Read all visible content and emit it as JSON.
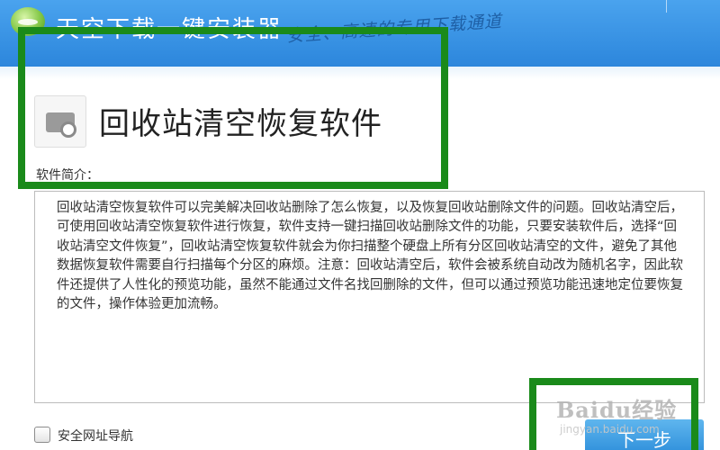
{
  "header": {
    "app_title": "天空下载一键安装器",
    "slogan": "安全、高速的专用下载通道"
  },
  "product": {
    "name": "回收站清空恢复软件",
    "icon": "disk-recovery-icon"
  },
  "intro": {
    "label": "软件简介：",
    "text": "回收站清空恢复软件可以完美解决回收站删除了怎么恢复，以及恢复回收站删除文件的问题。回收站清空后，可使用回收站清空恢复软件进行恢复，软件支持一键扫描回收站删除文件的功能，只要安装软件后，选择“回收站清空文件恢复”，回收站清空恢复软件就会为你扫描整个硬盘上所有分区回收站清空的文件，避免了其他数据恢复软件需要自行扫描每个分区的麻烦。注意：回收站清空后，软件会被系统自动改为随机名字，因此软件还提供了人性化的预览功能，虽然不能通过文件名找回删除的文件，但可以通过预览功能迅速地定位要恢复的文件，操作体验更加流畅。"
  },
  "footer": {
    "checkbox_label": "安全网址导航",
    "checkbox_checked": false,
    "next_button": "下一步"
  },
  "watermark": {
    "brand": "Baidu经验",
    "url": "jingyan.baidu.com"
  },
  "colors": {
    "header_blue": "#2c86dc",
    "highlight_green": "#1a8a1a",
    "button_blue": "#3494dd"
  }
}
